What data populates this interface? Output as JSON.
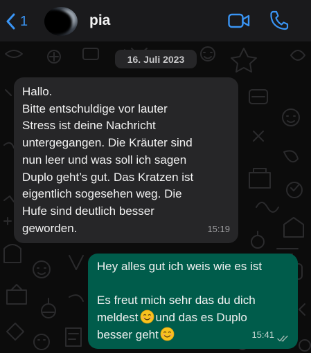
{
  "header": {
    "back_count": "1",
    "contact_name": "pia",
    "icons": {
      "back": "chevron-left-icon",
      "video": "video-camera-icon",
      "call": "phone-icon"
    },
    "accent_color": "#3a95f5"
  },
  "chat": {
    "date_separator": "16. Juli 2023",
    "messages": [
      {
        "direction": "incoming",
        "lines": [
          "Hallo.",
          "Bitte entschuldige vor lauter",
          "Stress ist deine Nachricht",
          "untergegangen. Die Kräuter sind",
          "nun leer und was soll ich sagen",
          "Duplo geht’s gut. Das Kratzen ist",
          "eigentlich sogesehen weg. Die",
          "Hufe sind deutlich besser",
          "geworden."
        ],
        "time": "15:19",
        "bubble_color": "#262628"
      },
      {
        "direction": "outgoing",
        "line1": "Hey alles gut ich weis wie es ist",
        "line2": "Es freut mich sehr das du dich",
        "line3_a": "meldest",
        "line3_b": "und das es Duplo",
        "line4": "besser geht",
        "emoji": "smiling-face-emoji",
        "time": "15:41",
        "status": "read-double-check",
        "bubble_color": "#005c4b"
      }
    ]
  }
}
